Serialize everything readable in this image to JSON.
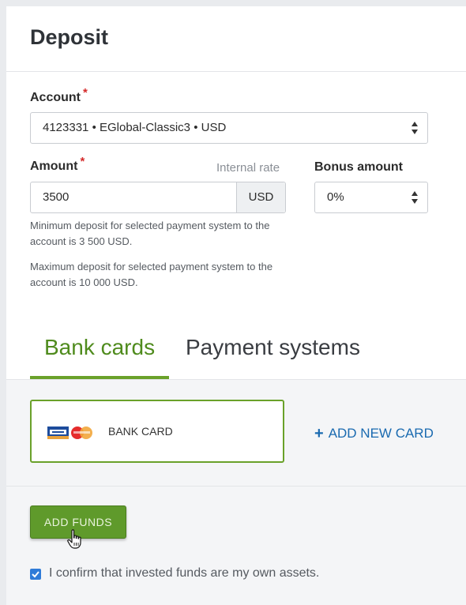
{
  "header": {
    "title": "Deposit"
  },
  "form": {
    "account_label": "Account",
    "required_mark": "*",
    "account_value": "4123331 • EGlobal-Classic3 • USD",
    "amount_label": "Amount",
    "internal_rate_label": "Internal rate",
    "amount_value": "3500",
    "currency": "USD",
    "bonus_label": "Bonus amount",
    "bonus_value": "0%",
    "min_hint": "Minimum deposit for selected payment system to the account is 3 500 USD.",
    "max_hint": "Maximum deposit for selected payment system to the account is 10 000 USD."
  },
  "tabs": [
    {
      "label": "Bank cards",
      "active": true
    },
    {
      "label": "Payment systems",
      "active": false
    }
  ],
  "cards": {
    "selected_card_label": "BANK CARD",
    "add_new_card_label": "ADD NEW CARD"
  },
  "footer": {
    "add_funds_label": "ADD FUNDS",
    "confirm_checked": true,
    "confirm_text": "I confirm that invested funds are my own assets."
  },
  "icons": {
    "select_arrows": "updown-arrows-icon",
    "card_brands": "visa-mastercard-icon",
    "plus": "plus-icon",
    "cursor": "hand-pointer-icon",
    "checkbox": "checkmark-icon"
  },
  "colors": {
    "accent_green": "#6aa12a",
    "link_blue": "#1a6ab0",
    "required_red": "#d42a2a",
    "button_green": "#5f9a2b"
  }
}
